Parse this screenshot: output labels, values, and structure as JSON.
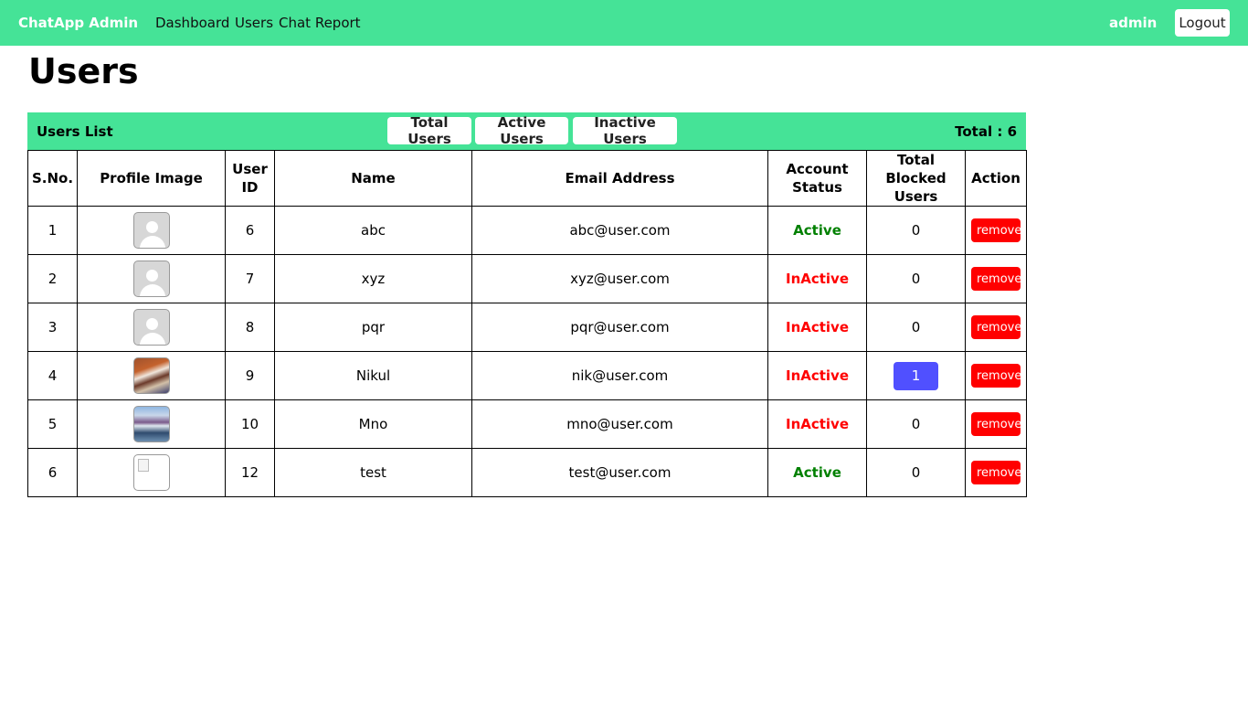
{
  "nav": {
    "brand": "ChatApp Admin",
    "links": [
      "Dashboard",
      "Users",
      "Chat Report"
    ],
    "user": "admin",
    "logout": "Logout"
  },
  "page": {
    "title": "Users"
  },
  "list": {
    "title": "Users List",
    "filters": [
      "Total Users",
      "Active Users",
      "Inactive Users"
    ],
    "total": "Total : 6"
  },
  "table": {
    "headers": [
      "S.No.",
      "Profile Image",
      "User ID",
      "Name",
      "Email Address",
      "Account Status",
      "Total Blocked Users",
      "Action"
    ],
    "rows": [
      {
        "sno": "1",
        "avatar": "default-avatar-icon",
        "id": "6",
        "name": "abc",
        "email": "abc@user.com",
        "status": "Active",
        "blocked": "0",
        "action": "remove"
      },
      {
        "sno": "2",
        "avatar": "default-avatar-icon",
        "id": "7",
        "name": "xyz",
        "email": "xyz@user.com",
        "status": "InActive",
        "blocked": "0",
        "action": "remove"
      },
      {
        "sno": "3",
        "avatar": "default-avatar-icon",
        "id": "8",
        "name": "pqr",
        "email": "pqr@user.com",
        "status": "InActive",
        "blocked": "0",
        "action": "remove"
      },
      {
        "sno": "4",
        "avatar": "photo-avatar",
        "id": "9",
        "name": "Nikul",
        "email": "nik@user.com",
        "status": "InActive",
        "blocked": "1",
        "action": "remove"
      },
      {
        "sno": "5",
        "avatar": "photo-avatar",
        "id": "10",
        "name": "Mno",
        "email": "mno@user.com",
        "status": "InActive",
        "blocked": "0",
        "action": "remove"
      },
      {
        "sno": "6",
        "avatar": "broken-image-icon",
        "id": "12",
        "name": "test",
        "email": "test@user.com",
        "status": "Active",
        "blocked": "0",
        "action": "remove"
      }
    ]
  },
  "colors": {
    "accent": "#45e397",
    "active": "#008000",
    "inactive": "#ff0000",
    "badge": "#5050ff",
    "remove": "#ff0000"
  }
}
